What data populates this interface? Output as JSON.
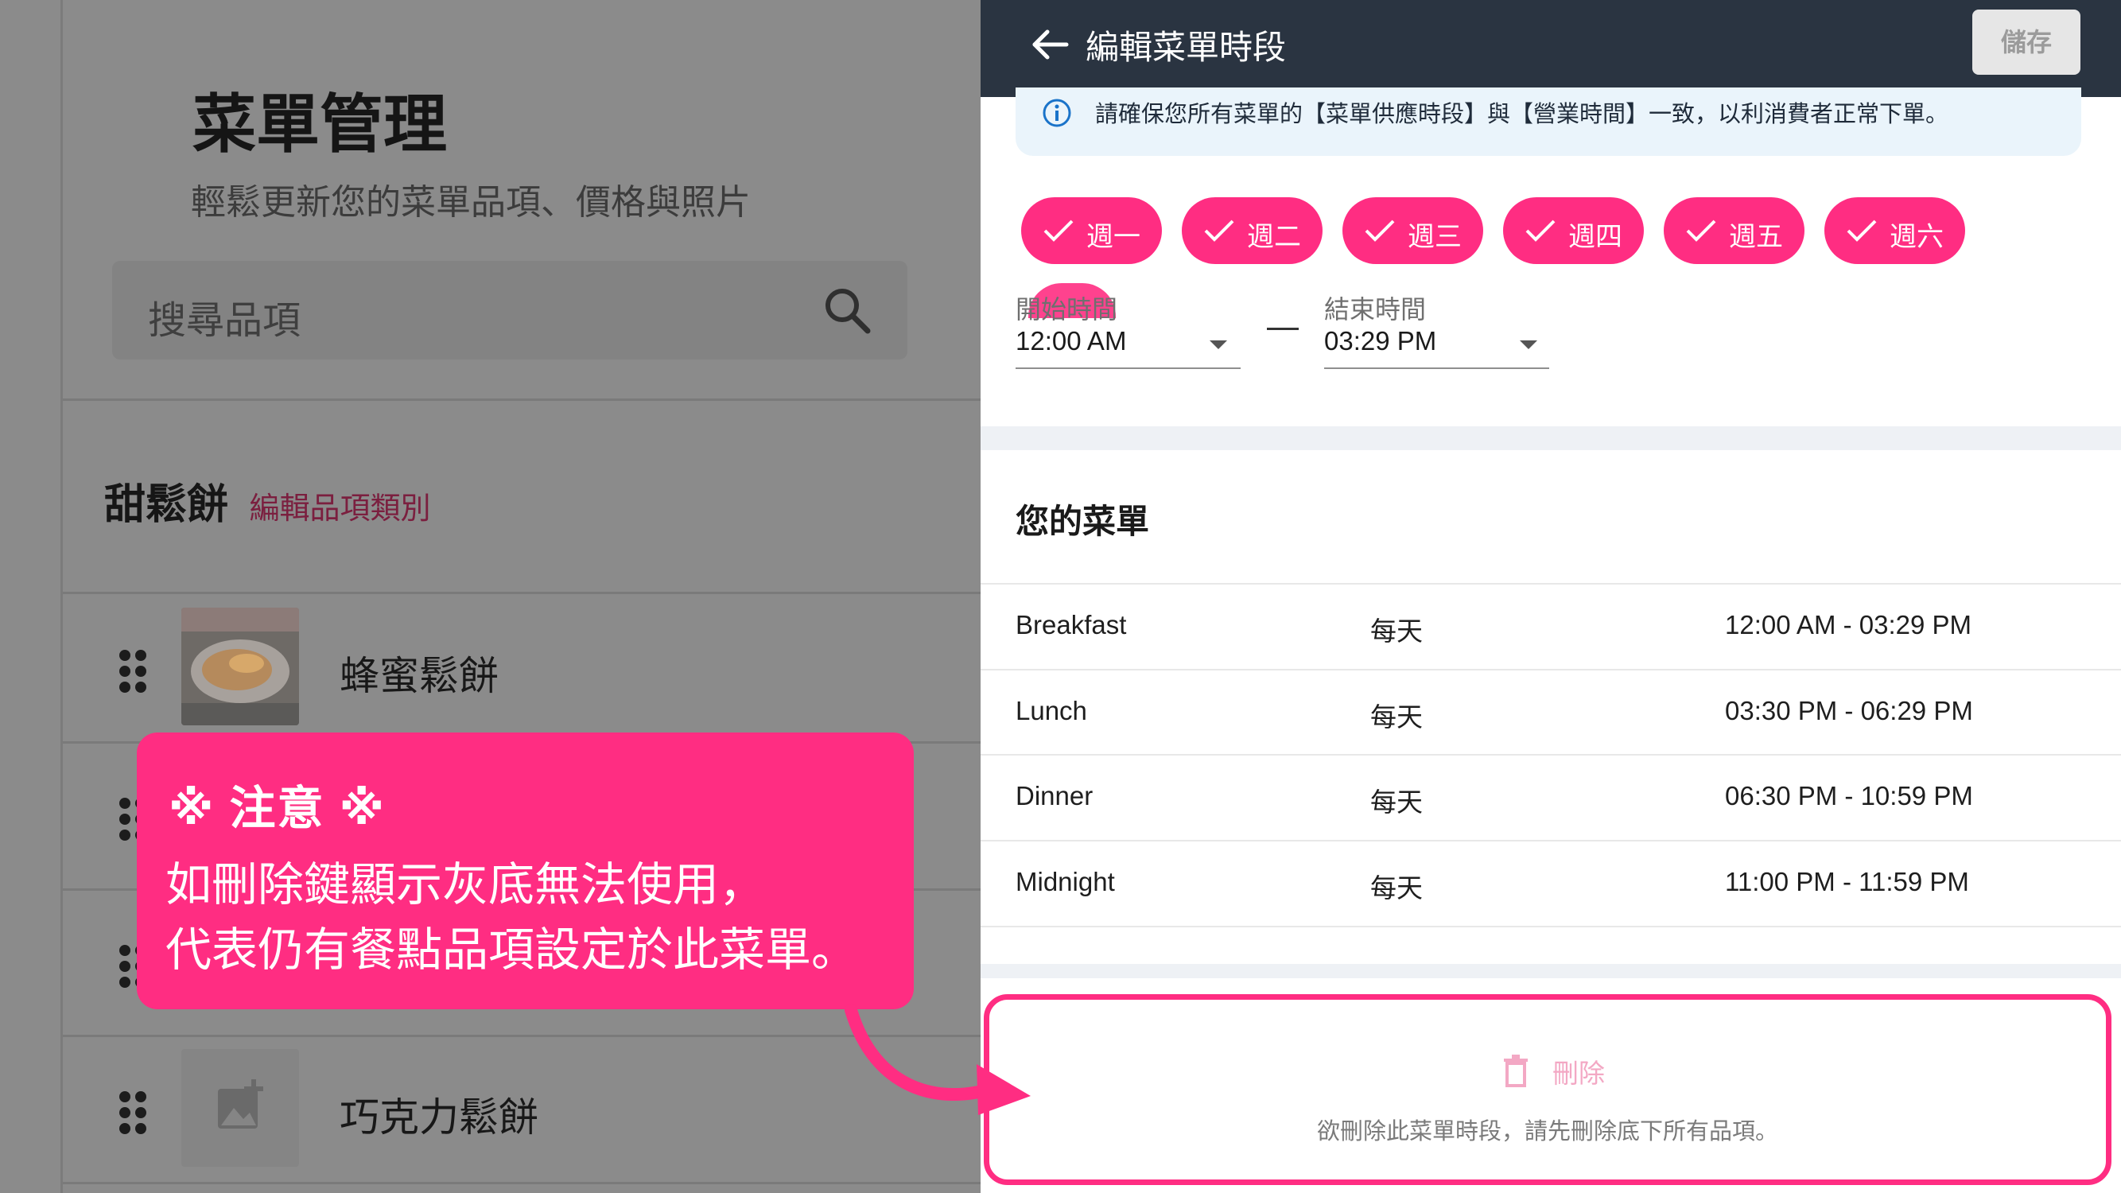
{
  "left_panel": {
    "title": "菜單管理",
    "subtitle": "輕鬆更新您的菜單品項、價格與照片",
    "search_placeholder": "搜尋品項",
    "category": {
      "name": "甜鬆餅",
      "edit_link": "編輯品項類別"
    },
    "items": [
      {
        "name": "蜂蜜鬆餅",
        "thumb": "food-photo"
      },
      {
        "name": "",
        "thumb": ""
      },
      {
        "name": "",
        "thumb": ""
      },
      {
        "name": "巧克力鬆餅",
        "thumb": "add-photo-icon"
      }
    ]
  },
  "note": {
    "heading": "※ 注意 ※",
    "line1": "如刪除鍵顯示灰底無法使用，",
    "line2": "代表仍有餐點品項設定於此菜單。",
    "color": "#ff2d82"
  },
  "editor": {
    "title": "編輯菜單時段",
    "save_label": "儲存",
    "info_text": "請確保您所有菜單的【菜單供應時段】與【營業時間】一致，以利消費者正常下單。",
    "days": [
      "週一",
      "週二",
      "週三",
      "週四",
      "週五",
      "週六"
    ],
    "start_label": "開始時間",
    "start_value": "12:00 AM",
    "end_label": "結束時間",
    "end_value": "03:29 PM",
    "menus_heading": "您的菜單",
    "menus": [
      {
        "name": "Breakfast",
        "days": "每天",
        "time": "12:00 AM - 03:29 PM"
      },
      {
        "name": "Lunch",
        "days": "每天",
        "time": "03:30 PM - 06:29 PM"
      },
      {
        "name": "Dinner",
        "days": "每天",
        "time": "06:30 PM - 10:59 PM"
      },
      {
        "name": "Midnight",
        "days": "每天",
        "time": "11:00 PM - 11:59 PM"
      }
    ],
    "delete_label": "刪除",
    "delete_hint": "欲刪除此菜單時段，請先刪除底下所有品項。"
  },
  "colors": {
    "accent": "#ff2d82",
    "topbar": "#2a3441",
    "info_bg": "#eaf4fb"
  }
}
